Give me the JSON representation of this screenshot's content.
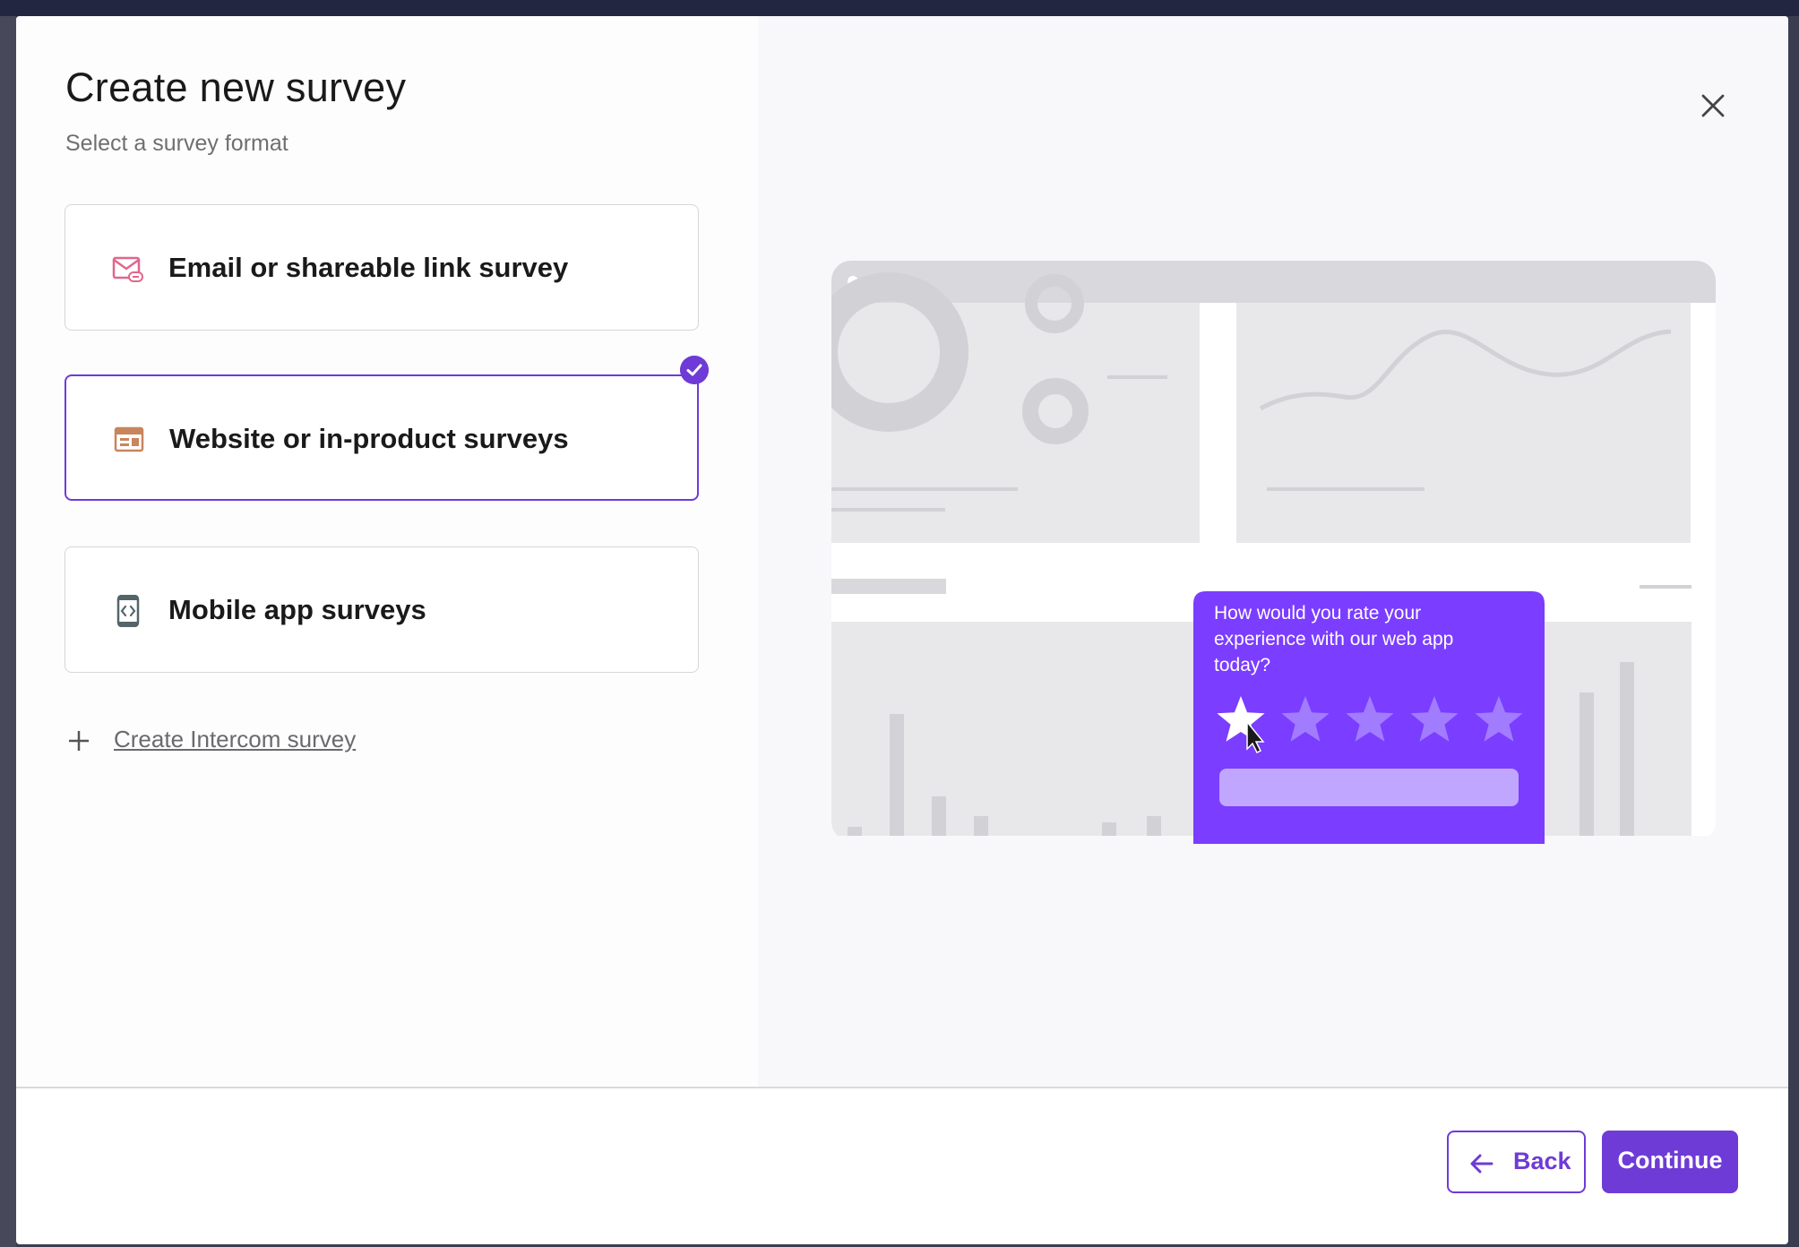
{
  "modal": {
    "title": "Create new survey",
    "subtitle": "Select a survey format",
    "close_icon": "close-icon"
  },
  "options": [
    {
      "label": "Email or shareable link survey",
      "icon": "email-link-icon",
      "icon_color": "#e0668d",
      "selected": false
    },
    {
      "label": "Website or in-product surveys",
      "icon": "browser-window-icon",
      "icon_color": "#c9855c",
      "selected": true
    },
    {
      "label": "Mobile app surveys",
      "icon": "mobile-code-icon",
      "icon_color": "#53656b",
      "selected": false
    }
  ],
  "create_link": {
    "label": "Create Intercom survey",
    "icon": "plus-icon"
  },
  "preview": {
    "question": "How would you rate your experience with our web app today?",
    "stars": 5,
    "selected_stars": 1
  },
  "footer": {
    "back_label": "Back",
    "continue_label": "Continue"
  },
  "colors": {
    "accent": "#6e3bd6",
    "survey_card": "#7b3dff",
    "preview_background": "#f8f7fa"
  }
}
